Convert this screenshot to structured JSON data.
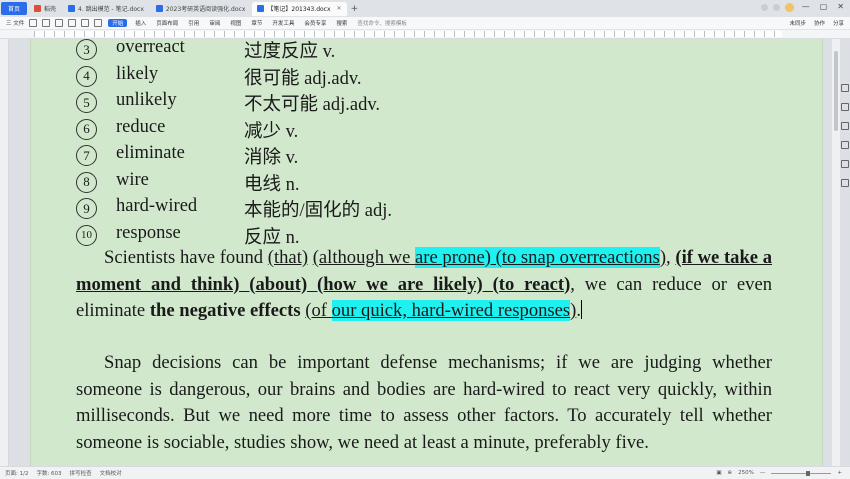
{
  "tabs": {
    "home": "首页",
    "items": [
      {
        "label": "稻壳",
        "color": "#e24a3a",
        "active": false
      },
      {
        "label": "4. 跳出模范 - 笔记.docx",
        "color": "#2b6de8",
        "active": false
      },
      {
        "label": "2023考研英语阅读强化.docx",
        "color": "#2b6de8",
        "active": false
      },
      {
        "label": "【笔记】201343.docx",
        "color": "#2b6de8",
        "active": true
      }
    ],
    "new_tab": "+"
  },
  "ribbon": {
    "file": "三 文件",
    "tabs": [
      "开始",
      "插入",
      "页面布局",
      "引用",
      "审阅",
      "视图",
      "章节",
      "开发工具",
      "会员专享",
      "搜索"
    ],
    "active_tab": "开始",
    "right_items": [
      "未同步",
      "协作",
      "分享"
    ],
    "search_hint": "查找命令、搜索模板"
  },
  "document": {
    "vocab": [
      {
        "num": "3",
        "word": "overreact",
        "meaning": "过度反应 v."
      },
      {
        "num": "4",
        "word": "likely",
        "meaning": "很可能 adj.adv."
      },
      {
        "num": "5",
        "word": "unlikely",
        "meaning": "不太可能 adj.adv."
      },
      {
        "num": "6",
        "word": "reduce",
        "meaning": "减少 v."
      },
      {
        "num": "7",
        "word": "eliminate",
        "meaning": "消除 v."
      },
      {
        "num": "8",
        "word": "wire",
        "meaning": "电线 n."
      },
      {
        "num": "9",
        "word": "hard-wired",
        "meaning": "本能的/固化的 adj."
      },
      {
        "num": "10",
        "word": "response",
        "meaning": "反应 n."
      }
    ],
    "para1": {
      "s1": "Scientists have found ",
      "s2": "(that)",
      "s3": " ",
      "s4": "(although we ",
      "s5": "are prone) (to snap overreactions",
      "s6": ")",
      "s7": ", ",
      "s8": "(if we take a moment and think) (about) (how we are likely) (to react)",
      "s9": ", we can reduce or even eliminate ",
      "s10": "the negative effects",
      "s11": " ",
      "s12": "(of ",
      "s13": "our quick, hard-wired responses",
      "s14": ")",
      "s15": "."
    },
    "para2": "Snap decisions can be important defense mechanisms; if we are judging whether someone is dangerous, our brains and bodies are hard-wired to react very quickly, within milliseconds. But we need more time to assess other factors. To accurately tell whether someone is sociable, studies show, we need at least a minute, preferably five."
  },
  "status": {
    "page": "页面: 1/2",
    "words": "字数: 603",
    "spell": "拼写检查",
    "proof": "文档校对",
    "zoom": "250%",
    "zoom_level": 0.62
  }
}
